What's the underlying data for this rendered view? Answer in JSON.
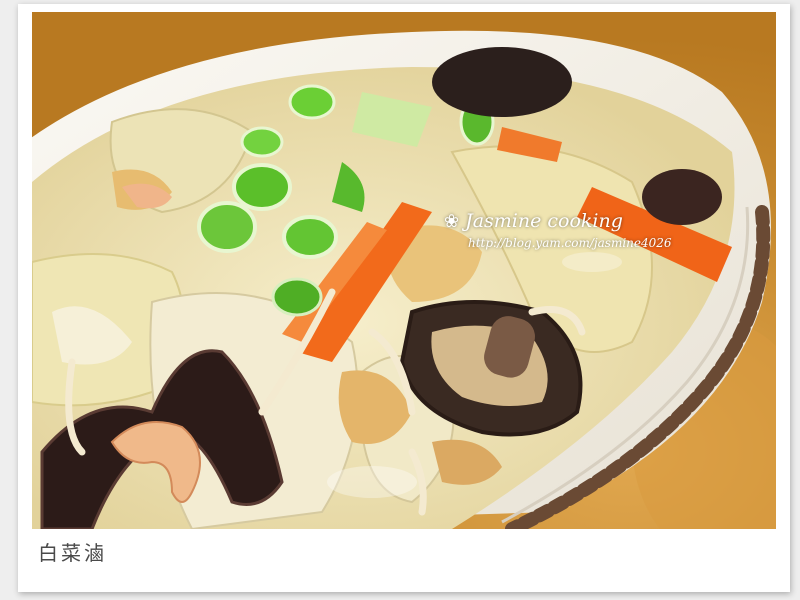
{
  "photo": {
    "caption": "白菜滷",
    "watermark_title": "Jasmine cooking",
    "watermark_url": "http://blog.yam.com/jasmine4026",
    "watermark_icon": "flower-icon"
  },
  "colors": {
    "background": "#eeeeee",
    "frame": "#ffffff",
    "table": "#c88a2e",
    "bowl": "#f4f1ea",
    "bowl_rim": "#6a4a34",
    "carrot": "#f26a1b",
    "scallion": "#5bbf2a",
    "mushroom": "#3a2a22",
    "cabbage": "#f1e7b8"
  }
}
